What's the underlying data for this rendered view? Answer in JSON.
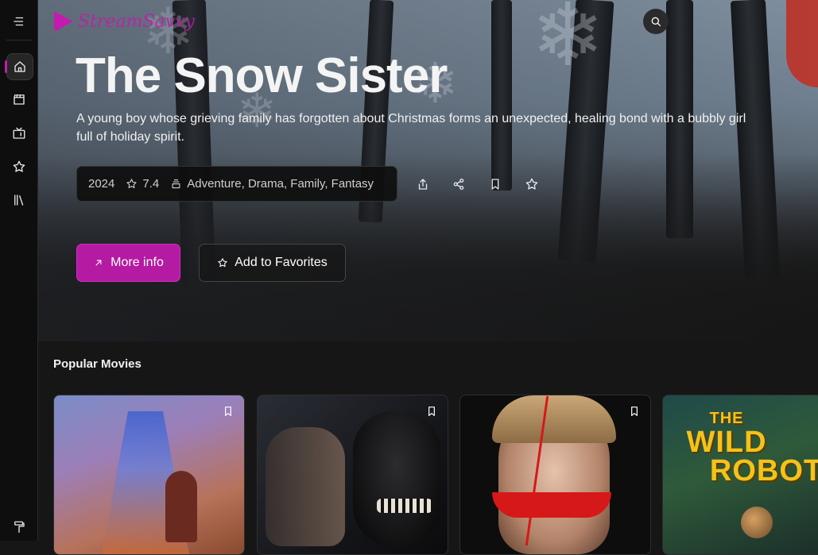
{
  "app": {
    "brand_name": "StreamSavvy",
    "brand_color": "#c21cae"
  },
  "sidebar": {
    "items": [
      {
        "name": "menu",
        "icon": "menu-icon"
      },
      {
        "name": "home",
        "icon": "home-icon",
        "active": true
      },
      {
        "name": "movies",
        "icon": "clapperboard-icon"
      },
      {
        "name": "tv",
        "icon": "tv-icon"
      },
      {
        "name": "favorites",
        "icon": "star-icon"
      },
      {
        "name": "library",
        "icon": "library-icon"
      },
      {
        "name": "theme",
        "icon": "paint-roller-icon"
      }
    ]
  },
  "hero": {
    "title": "The Snow Sister",
    "description": "A young boy whose grieving family has forgotten about Christmas forms an unexpected, healing bond with a bubbly girl full of holiday spirit.",
    "year": "2024",
    "rating": "7.4",
    "genres": "Adventure, Drama, Family, Fantasy",
    "actions": [
      "share-icon",
      "share-nodes-icon",
      "bookmark-icon",
      "star-icon"
    ],
    "more_info_label": "More info",
    "add_favorites_label": "Add to Favorites"
  },
  "popular": {
    "title": "Popular Movies",
    "cards": [
      {
        "poster": "moana-poster"
      },
      {
        "poster": "venom-poster"
      },
      {
        "poster": "smile-poster"
      },
      {
        "poster": "wild-robot-poster",
        "poster_text_1": "THE",
        "poster_text_2": "WILD",
        "poster_text_3": "ROBOT"
      }
    ]
  }
}
